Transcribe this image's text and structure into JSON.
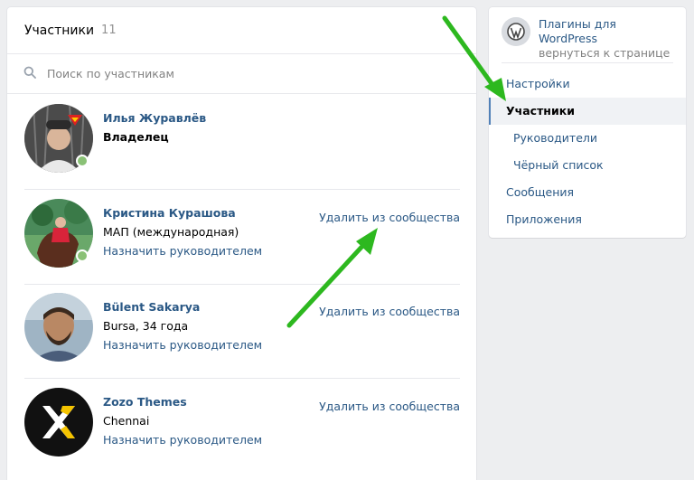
{
  "header": {
    "title": "Участники",
    "count": "11"
  },
  "search": {
    "placeholder": "Поиск по участникам",
    "icon": "search-icon"
  },
  "members": [
    {
      "name": "Илья Журавлёв",
      "subtitle": "Владелец",
      "online": true
    },
    {
      "name": "Кристина Курашова",
      "subtitle": "МАП (международная)",
      "action": "Назначить руководителем",
      "remove": "Удалить из сообщества",
      "online": true
    },
    {
      "name": "Bülent Sakarya",
      "subtitle": "Bursa, 34 года",
      "action": "Назначить руководителем",
      "remove": "Удалить из сообщества",
      "online": false
    },
    {
      "name": "Zozo Themes",
      "subtitle": "Chennai",
      "action": "Назначить руководителем",
      "remove": "Удалить из сообщества",
      "online": false
    }
  ],
  "sidebar": {
    "group_name": "Плагины для WordPress",
    "back_link": "вернуться к странице",
    "menu": [
      {
        "label": "Настройки"
      },
      {
        "label": "Участники"
      },
      {
        "label": "Руководители"
      },
      {
        "label": "Чёрный список"
      },
      {
        "label": "Сообщения"
      },
      {
        "label": "Приложения"
      }
    ]
  },
  "colors": {
    "accent": "#2a5885",
    "online": "#8ac176",
    "arrow": "#2db81f",
    "background": "#edeef0"
  }
}
